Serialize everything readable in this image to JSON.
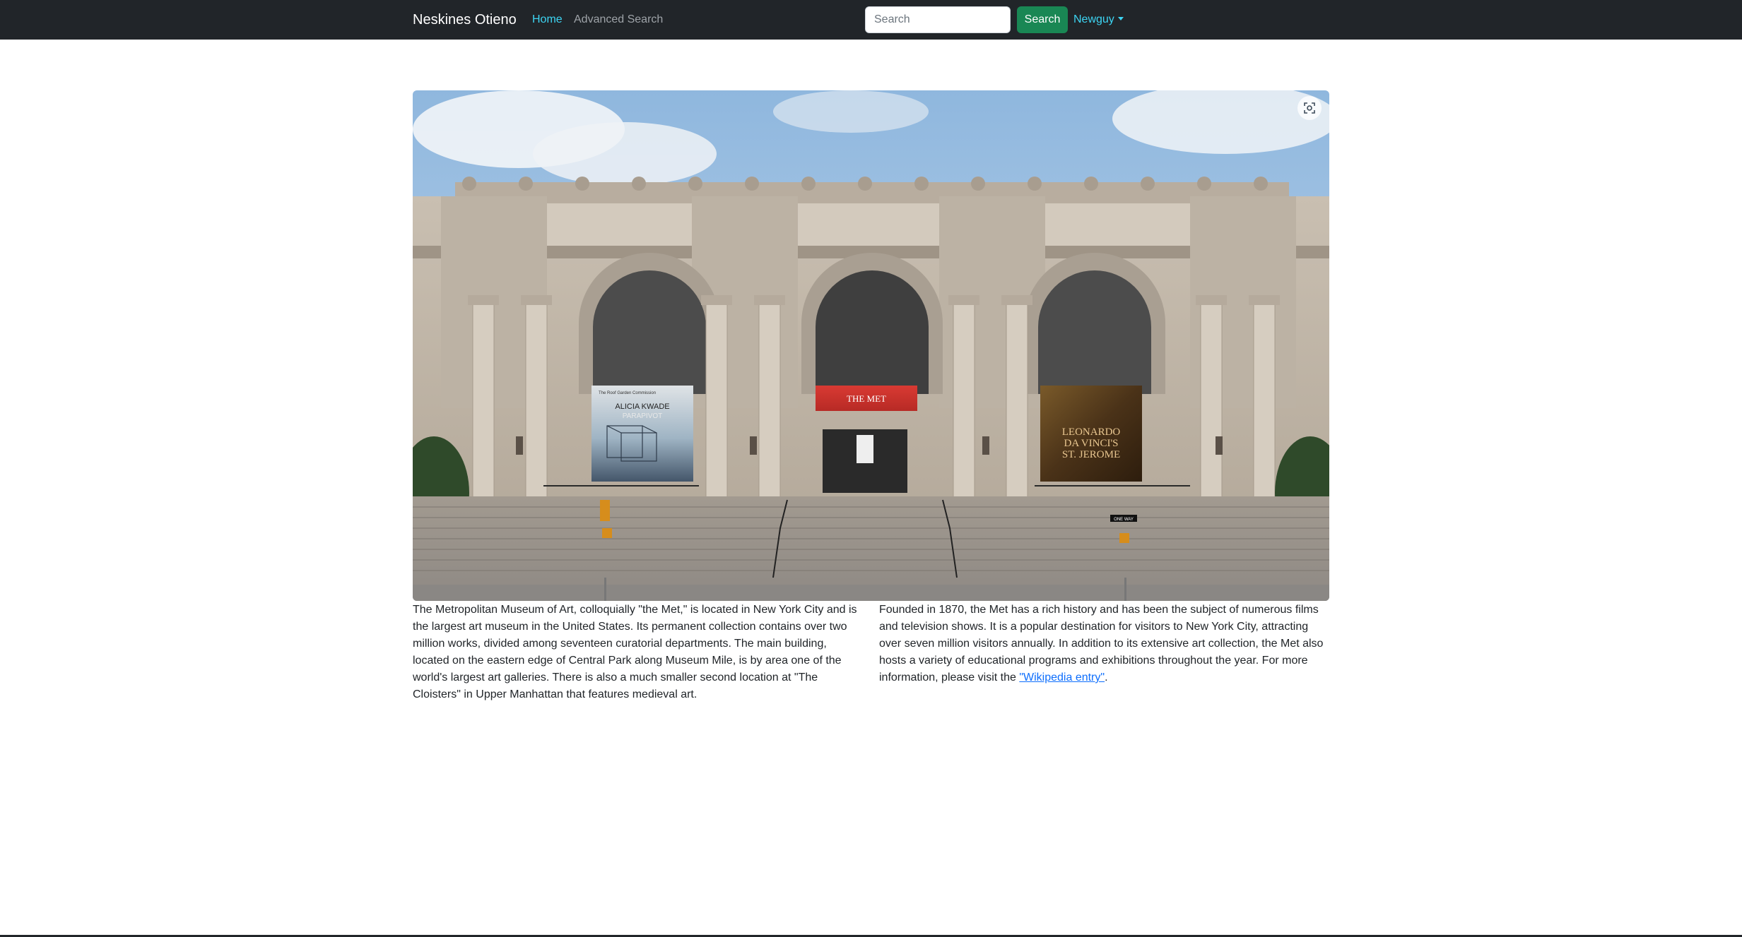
{
  "navbar": {
    "brand": "Neskines Otieno",
    "links": [
      {
        "label": "Home",
        "active": true
      },
      {
        "label": "Advanced Search",
        "active": false
      }
    ],
    "search": {
      "placeholder": "Search",
      "value": "",
      "button_label": "Search"
    },
    "user_menu": {
      "label": "Newguy"
    }
  },
  "hero": {
    "banners": {
      "left_small": "The Roof Garden Commission",
      "left_title": "ALICIA KWADE",
      "left_subtitle": "PARAPIVOT",
      "center": "THE MET",
      "right_line1": "LEONARDO",
      "right_line2": "DA VINCI'S",
      "right_line3": "ST. JEROME"
    },
    "street_sign": "ONE WAY",
    "expand_icon": "fullscreen-icon"
  },
  "content": {
    "left_paragraph": "The Metropolitan Museum of Art, colloquially \"the Met,\" is located in New York City and is the largest art museum in the United States. Its permanent collection contains over two million works, divided among seventeen curatorial departments. The main building, located on the eastern edge of Central Park along Museum Mile, is by area one of the world's largest art galleries. There is also a much smaller second location at \"The Cloisters\" in Upper Manhattan that features medieval art.",
    "right_paragraph_prefix": "Founded in 1870, the Met has a rich history and has been the subject of numerous films and television shows. It is a popular destination for visitors to New York City, attracting over seven million visitors annually. In addition to its extensive art collection, the Met also hosts a variety of educational programs and exhibitions throughout the year. For more information, please visit the ",
    "wikipedia_link": "\"Wikipedia entry\"",
    "right_paragraph_suffix": "."
  },
  "colors": {
    "navbar_bg": "#212529",
    "accent": "#3dd5f3",
    "search_button": "#198754",
    "link": "#0d6efd"
  }
}
